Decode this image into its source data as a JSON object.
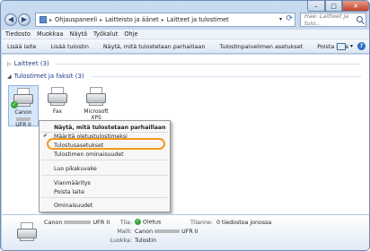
{
  "window": {
    "controls": {
      "minimize": "–",
      "maximize": "□",
      "close": "✕"
    }
  },
  "address": {
    "segments": [
      "Ohjauspaneeli",
      "Laitteisto ja äänet",
      "Laitteet ja tulostimet"
    ],
    "separator": "▸"
  },
  "search": {
    "placeholder": "Hae: Laitteet ja tulo..."
  },
  "menubar": [
    "Tiedosto",
    "Muokkaa",
    "Näytä",
    "Työkalut",
    "Ohje"
  ],
  "toolbar": [
    "Lisää laite",
    "Lisää tulostin",
    "Näytä, mitä tulostetaan parhaillaan",
    "Tulostinpalvelimen asetukset",
    "Poista laite"
  ],
  "groups": {
    "devices": {
      "label": "Laitteet (3)",
      "arrow": "▷"
    },
    "printers": {
      "label": "Tulostimet ja faksit (3)",
      "arrow": "◢"
    }
  },
  "printers": [
    {
      "line1": "Canon",
      "line2": "UFR II",
      "selected": true,
      "default": true
    },
    {
      "line1": "Fax",
      "line2": "",
      "selected": false,
      "default": false
    },
    {
      "line1": "Microsoft",
      "line2": "XPS",
      "selected": false,
      "default": false
    }
  ],
  "context_menu": {
    "items": [
      {
        "label": "Näytä, mitä tulostetaan parhaillaan",
        "bold": true
      },
      {
        "label": "Määritä oletustulostimeksi",
        "checked": true
      },
      {
        "label": "Tulostusasetukset",
        "highlighted": true
      },
      {
        "label": "Tulostimen ominaisuudet"
      },
      {
        "label": "Luo pikakuvake"
      },
      {
        "label": "Vianmääritys"
      },
      {
        "label": "Poista laite"
      },
      {
        "label": "Ominaisuudet"
      }
    ],
    "check_glyph": "✔"
  },
  "details": {
    "name_prefix": "Canon",
    "name_suffix": "UFR II",
    "tila_label": "Tila:",
    "tila_value": "Oletus",
    "malli_label": "Malli:",
    "malli_prefix": "Canon",
    "malli_suffix": "UFR II",
    "luokka_label": "Luokka:",
    "luokka_value": "Tulostin",
    "tilanne_label": "Tilanne:",
    "tilanne_value": "0 tiedostoa jonossa"
  },
  "colors": {
    "accent": "#1f3a8a",
    "highlight_ring": "#f29a18",
    "ok_green": "#3aa535"
  }
}
